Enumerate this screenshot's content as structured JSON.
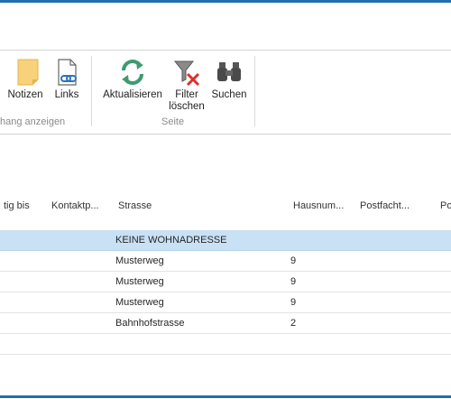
{
  "ribbon": {
    "buttons": {
      "notes": "Notizen",
      "links": "Links",
      "refresh": "Aktualisieren",
      "clear_filter_line1": "Filter",
      "clear_filter_line2": "löschen",
      "search": "Suchen"
    },
    "groups": {
      "attachments": "hang anzeigen",
      "page": "Seite"
    }
  },
  "table": {
    "columns": [
      "tig bis",
      "Kontaktp...",
      "Strasse",
      "Hausnum...",
      "Postfacht...",
      "Po"
    ],
    "rows": [
      {
        "strasse": "KEINE WOHNADRESSE",
        "hausnummer": "",
        "selected": true
      },
      {
        "strasse": "Musterweg",
        "hausnummer": "9",
        "selected": false
      },
      {
        "strasse": "Musterweg",
        "hausnummer": "9",
        "selected": false
      },
      {
        "strasse": "Musterweg",
        "hausnummer": "9",
        "selected": false
      },
      {
        "strasse": "Bahnhofstrasse",
        "hausnummer": "2",
        "selected": false
      },
      {
        "strasse": "",
        "hausnummer": "",
        "selected": false
      }
    ]
  },
  "colors": {
    "accent": "#1f6fb2",
    "selected_row": "#c9e1f4",
    "refresh_icon": "#3f9b6f",
    "filter_x": "#d9322b"
  },
  "icons": [
    "notes-icon",
    "links-icon",
    "refresh-icon",
    "clear-filter-icon",
    "search-binoculars-icon"
  ]
}
